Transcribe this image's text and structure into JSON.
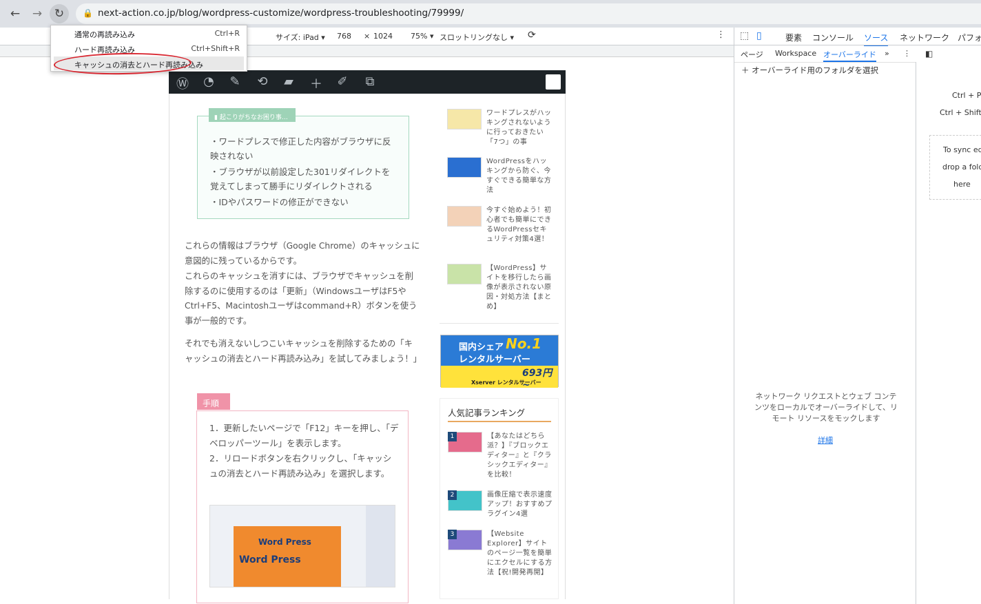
{
  "browser": {
    "url": "next-action.co.jp/blog/wordpress-customize/wordpress-troubleshooting/79999/"
  },
  "device_toolbar": {
    "size_label": "サイズ: iPad ▾",
    "width": "768",
    "times": "×",
    "height": "1024",
    "zoom": "75% ▾",
    "throttle": "スロットリングなし ▾"
  },
  "context_menu": {
    "items": [
      {
        "label": "通常の再読み込み",
        "shortcut": "Ctrl+R"
      },
      {
        "label": "ハード再読み込み",
        "shortcut": "Ctrl+Shift+R"
      },
      {
        "label": "キャッシュの消去とハード再読み込み",
        "shortcut": ""
      }
    ]
  },
  "article": {
    "trouble_tag": "▮ 起こりがちなお困り事…",
    "trouble_items": [
      "・ワードプレスで修正した内容がブラウザに反映されない",
      "・ブラウザが以前設定した301リダイレクトを覚えてしまって勝手にリダイレクトされる",
      "・IDやパスワードの修正ができない"
    ],
    "para1": "これらの情報はブラウザ（Google Chrome）のキャッシュに意図的に残っているからです。",
    "para2": "これらのキャッシュを消すには、ブラウザでキャッシュを削除するのに使用するのは「更新」（WindowsユーザはF5やCtrl+F5、Macintoshユーザはcommand+R）ボタンを使う事が一般的です。",
    "para3": "それでも消えないしつこいキャッシュを削除するための「キャッシュの消去とハード再読み込み」を試してみましょう！」",
    "steps_tag": "手順",
    "step1": "1．更新したいページで「F12」キーを押し、「デベロッパーツール」を表示します。",
    "step2": "2．リロードボタンを右クリックし、「キャッシュの消去とハード再読み込み」を選択します。",
    "shot_text1": "Word Press",
    "shot_text2": "Word Press"
  },
  "sidebar": {
    "top_items": [
      {
        "title": "ワードプレスがハッキングされないように行っておきたい「7つ」の事",
        "color": "#f6e7a8"
      },
      {
        "title": "WordPressをハッキングから防ぐ、今すぐできる簡単な方法",
        "color": "#2a6fd1"
      },
      {
        "title": "今すぐ始めよう！初心者でも簡単にできるWordPressセキュリティ対策4選！",
        "color": "#f3d2b8"
      },
      {
        "title": "【WordPress】サイトを移行したら画像が表示されない原因・対処方法【まとめ】",
        "color": "#c9e3a8"
      }
    ],
    "ad": {
      "line1": "国内シェア",
      "no1": "No.1",
      "line2": "レンタルサーバー",
      "price": "693円~",
      "brand": "Xserver レンタルサーバー"
    },
    "ranking_title": "人気記事ランキング",
    "ranking": [
      {
        "rank": "1",
        "title": "【あなたはどちら派？】『ブロックエディター』と『クラシックエディター』を比較！"
      },
      {
        "rank": "2",
        "title": "画像圧縮で表示速度アップ！おすすめプラグイン4選"
      },
      {
        "rank": "3",
        "title": "【Website Explorer】サイトのページ一覧を簡単にエクセルにする方法【祝!開発再開】"
      }
    ]
  },
  "devtools": {
    "tabs": [
      "要素",
      "コンソール",
      "ソース",
      "ネットワーク",
      "パフォー"
    ],
    "subtabs": [
      "ページ",
      "Workspace",
      "オーバーライド"
    ],
    "select_folder": "＋ オーバーライド用のフォルダを選択",
    "desc": "ネットワーク リクエストとウェブ コンテンツをローカルでオーバーライドして、リモート リソースをモックします",
    "link": "詳細",
    "right_hint1": "Ctrl + P",
    "right_hint2": "Ctrl + Shift +",
    "sync1": "To sync ed",
    "sync2": "drop a fold",
    "sync3": "here"
  },
  "colors": {
    "accent": "#1a73e8",
    "oval": "#d8242e"
  }
}
